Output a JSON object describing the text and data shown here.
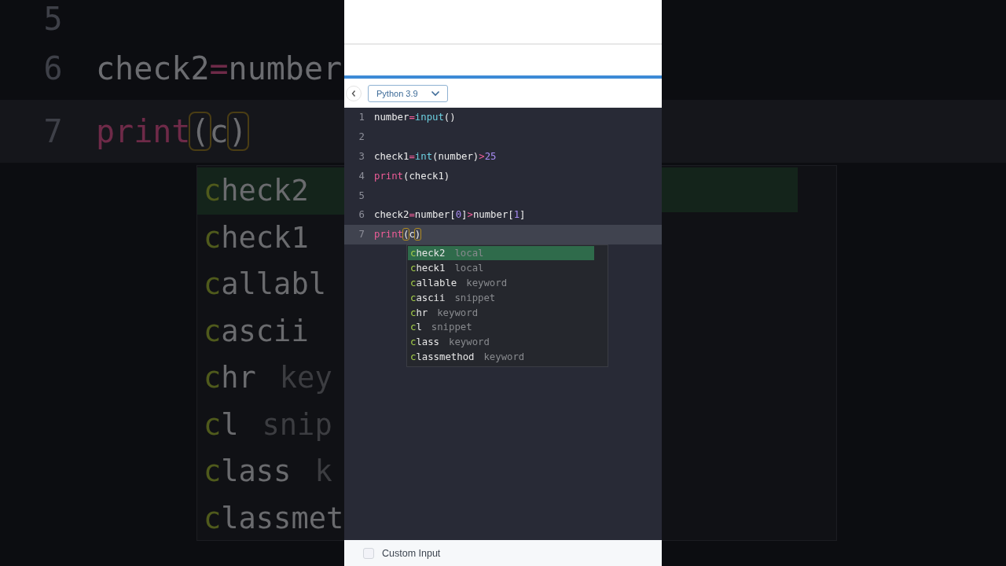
{
  "backdrop": {
    "lines": [
      {
        "number": "5"
      },
      {
        "number": "6",
        "tokens": [
          {
            "text": "check2",
            "kind": "name"
          },
          {
            "text": "=",
            "kind": "op"
          },
          {
            "text": "number",
            "kind": "name"
          }
        ]
      },
      {
        "number": "7",
        "current": true,
        "tokens": [
          {
            "text": "print",
            "kind": "keyword"
          },
          {
            "text": "(",
            "kind": "match"
          },
          {
            "text": "c",
            "kind": "name"
          },
          {
            "text": ")",
            "kind": "match"
          }
        ]
      }
    ],
    "suggestions": [
      {
        "match": "c",
        "rest": "heck2",
        "selected": true
      },
      {
        "match": "c",
        "rest": "heck1",
        "selected": false
      },
      {
        "match": "c",
        "rest": "allabl",
        "selected": false
      },
      {
        "match": "c",
        "rest": "ascii",
        "selected": false
      },
      {
        "match": "c",
        "rest": "hr",
        "type": "key",
        "selected": false
      },
      {
        "match": "c",
        "rest": "l",
        "type": "snip",
        "selected": false
      },
      {
        "match": "c",
        "rest": "lass",
        "type": "k",
        "selected": false
      },
      {
        "match": "c",
        "rest": "lassmet",
        "selected": false
      }
    ]
  },
  "toolbar": {
    "language": "Python 3.9"
  },
  "editor": {
    "lines": [
      {
        "number": "1",
        "current": false,
        "tokens": [
          {
            "text": "number",
            "kind": "name"
          },
          {
            "text": "=",
            "kind": "op"
          },
          {
            "text": "input",
            "kind": "builtin"
          },
          {
            "text": "()",
            "kind": "punct"
          }
        ]
      },
      {
        "number": "2",
        "current": false
      },
      {
        "number": "3",
        "current": false,
        "tokens": [
          {
            "text": "check1",
            "kind": "name"
          },
          {
            "text": "=",
            "kind": "op"
          },
          {
            "text": "int",
            "kind": "builtin"
          },
          {
            "text": "(number)",
            "kind": "punct"
          },
          {
            "text": ">",
            "kind": "op"
          },
          {
            "text": "25",
            "kind": "number"
          }
        ]
      },
      {
        "number": "4",
        "current": false,
        "tokens": [
          {
            "text": "print",
            "kind": "keyword"
          },
          {
            "text": "(check1)",
            "kind": "punct"
          }
        ]
      },
      {
        "number": "5",
        "current": false
      },
      {
        "number": "6",
        "current": false,
        "tokens": [
          {
            "text": "check2",
            "kind": "name"
          },
          {
            "text": "=",
            "kind": "op"
          },
          {
            "text": "number[",
            "kind": "punct"
          },
          {
            "text": "0",
            "kind": "number"
          },
          {
            "text": "]",
            "kind": "punct"
          },
          {
            "text": ">",
            "kind": "op"
          },
          {
            "text": "number[",
            "kind": "punct"
          },
          {
            "text": "1",
            "kind": "number"
          },
          {
            "text": "]",
            "kind": "punct"
          }
        ]
      },
      {
        "number": "7",
        "current": true,
        "tokens": [
          {
            "text": "print",
            "kind": "keyword"
          },
          {
            "text": "(",
            "kind": "match"
          },
          {
            "text": "c",
            "kind": "name"
          },
          {
            "text": ")",
            "kind": "match"
          }
        ]
      }
    ],
    "suggestions": [
      {
        "match": "c",
        "rest": "heck2",
        "type": "local",
        "selected": true
      },
      {
        "match": "c",
        "rest": "heck1",
        "type": "local",
        "selected": false
      },
      {
        "match": "c",
        "rest": "allable",
        "type": "keyword",
        "selected": false
      },
      {
        "match": "c",
        "rest": "ascii",
        "type": "snippet",
        "selected": false
      },
      {
        "match": "c",
        "rest": "hr",
        "type": "keyword",
        "selected": false
      },
      {
        "match": "c",
        "rest": "l",
        "type": "snippet",
        "selected": false
      },
      {
        "match": "c",
        "rest": "lass",
        "type": "keyword",
        "selected": false
      },
      {
        "match": "c",
        "rest": "lassmethod",
        "type": "keyword",
        "selected": false
      }
    ]
  },
  "footer": {
    "custom_input": {
      "label": "Custom Input",
      "checked": false
    }
  }
}
